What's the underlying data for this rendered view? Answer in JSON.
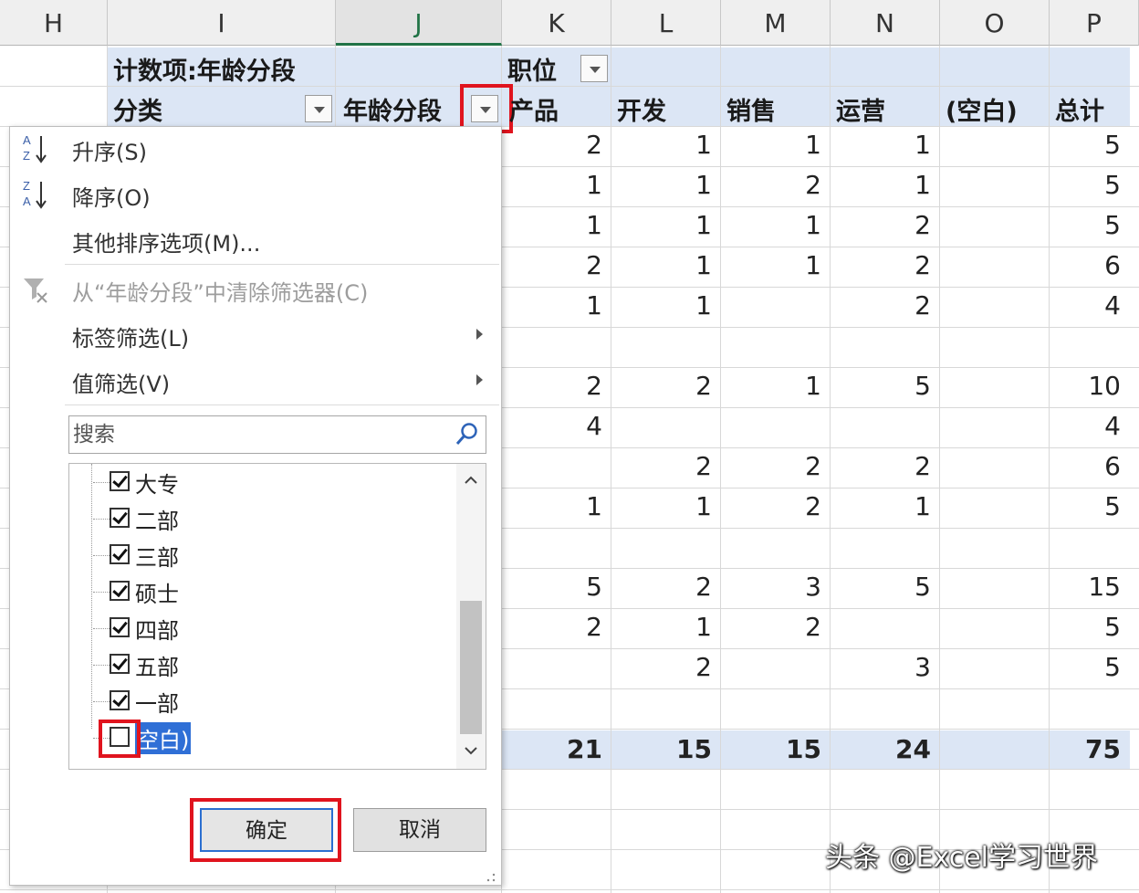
{
  "columns": [
    "H",
    "I",
    "J",
    "K",
    "L",
    "M",
    "N",
    "O",
    "P"
  ],
  "pivot": {
    "count_label": "计数项:年龄分段",
    "column_field": "职位",
    "row_field_1": "分类",
    "row_field_2": "年龄分段",
    "col_headers": [
      "产品",
      "开发",
      "销售",
      "运营",
      "(空白)",
      "总计"
    ],
    "rows": [
      [
        "2",
        "1",
        "1",
        "1",
        "",
        "5"
      ],
      [
        "1",
        "1",
        "2",
        "1",
        "",
        "5"
      ],
      [
        "1",
        "1",
        "1",
        "2",
        "",
        "5"
      ],
      [
        "2",
        "1",
        "1",
        "2",
        "",
        "6"
      ],
      [
        "1",
        "1",
        "",
        "2",
        "",
        "4"
      ],
      [
        "",
        "",
        "",
        "",
        "",
        ""
      ],
      [
        "2",
        "2",
        "1",
        "5",
        "",
        "10"
      ],
      [
        "4",
        "",
        "",
        "",
        "",
        "4"
      ],
      [
        "",
        "2",
        "2",
        "2",
        "",
        "6"
      ],
      [
        "1",
        "1",
        "2",
        "1",
        "",
        "5"
      ],
      [
        "",
        "",
        "",
        "",
        "",
        ""
      ],
      [
        "5",
        "2",
        "3",
        "5",
        "",
        "15"
      ],
      [
        "2",
        "1",
        "2",
        "",
        "",
        "5"
      ],
      [
        "",
        "2",
        "",
        "3",
        "",
        "5"
      ],
      [
        "",
        "",
        "",
        "",
        "",
        ""
      ]
    ],
    "totals": [
      "21",
      "15",
      "15",
      "24",
      "",
      "75"
    ]
  },
  "filter_menu": {
    "sort_asc": "升序(S)",
    "sort_desc": "降序(O)",
    "more_sort": "其他排序选项(M)...",
    "clear_filter": "从“年龄分段”中清除筛选器(C)",
    "label_filter": "标签筛选(L)",
    "value_filter": "值筛选(V)",
    "search_placeholder": "搜索",
    "items": [
      {
        "label": "大专",
        "checked": true
      },
      {
        "label": "二部",
        "checked": true
      },
      {
        "label": "三部",
        "checked": true
      },
      {
        "label": "硕士",
        "checked": true
      },
      {
        "label": "四部",
        "checked": true
      },
      {
        "label": "五部",
        "checked": true
      },
      {
        "label": "一部",
        "checked": true
      },
      {
        "label": "空白)",
        "checked": false
      }
    ],
    "ok_label": "确定",
    "cancel_label": "取消"
  },
  "watermark": "头条 @Excel学习世界",
  "colors": {
    "pivot_band": "#dce6f5",
    "highlight_red": "#e0141e",
    "selection_blue": "#2f6fd6",
    "excel_green": "#217346"
  }
}
